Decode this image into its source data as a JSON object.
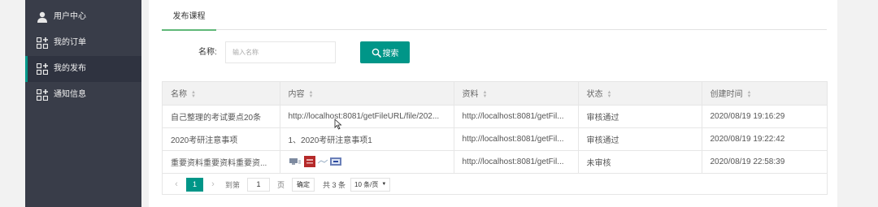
{
  "sidebar": {
    "items": [
      {
        "label": "用户中心",
        "icon": "user-icon"
      },
      {
        "label": "我的订单",
        "icon": "grid-icon"
      },
      {
        "label": "我的发布",
        "icon": "grid-icon"
      },
      {
        "label": "通知信息",
        "icon": "grid-icon"
      }
    ],
    "active_index": 2
  },
  "tabs": [
    {
      "label": "发布课程"
    }
  ],
  "search": {
    "label": "名称:",
    "placeholder": "输入名称",
    "value": "",
    "button_label": "搜索"
  },
  "table": {
    "columns": [
      "名称",
      "内容",
      "资料",
      "状态",
      "创建时间"
    ],
    "rows": [
      {
        "name": "自己整理的考试要点20条",
        "content": "http://localhost:8081/getFileURL/file/202...",
        "material": "http://localhost:8081/getFil...",
        "status": "审核通过",
        "created": "2020/08/19 19:16:29"
      },
      {
        "name": "2020考研注意事项",
        "content": "1、2020考研注意事项1",
        "material": "http://localhost:8081/getFil...",
        "status": "审核通过",
        "created": "2020/08/19 19:22:42"
      },
      {
        "name": "重要资料重要资料重要资...",
        "content": "",
        "material": "http://localhost:8081/getFil...",
        "status": "未审核",
        "created": "2020/08/19 22:58:39"
      }
    ]
  },
  "pagination": {
    "prev": "‹",
    "next": "›",
    "current_page": "1",
    "goto_label": "到第",
    "goto_value": "1",
    "page_label": "页",
    "confirm_label": "确定",
    "total_label": "共 3 条",
    "page_size_label": "10 条/页",
    "page_size_arrow": "▼"
  },
  "colors": {
    "sidebar_bg": "#393d49",
    "accent": "#009688",
    "tab_underline": "#5fb878"
  }
}
